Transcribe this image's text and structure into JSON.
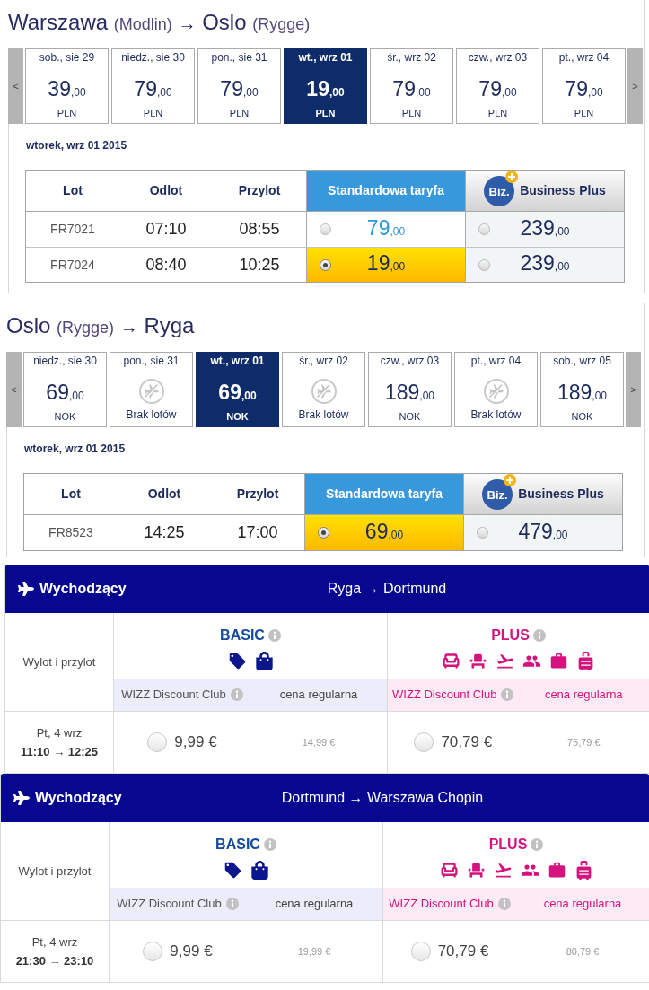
{
  "flights": [
    {
      "route": {
        "from": "Warszawa",
        "from_airport": "(Modlin)",
        "arrow": "→",
        "to": "Oslo",
        "to_airport": "(Rygge)"
      },
      "prev": "<",
      "next": ">",
      "dates": [
        {
          "kind": "price",
          "label": "sob., sie 29",
          "amount": "39",
          "fraction": ",00",
          "currency": "PLN",
          "selected": false
        },
        {
          "kind": "price",
          "label": "niedz., sie 30",
          "amount": "79",
          "fraction": ",00",
          "currency": "PLN",
          "selected": false
        },
        {
          "kind": "price",
          "label": "pon., sie 31",
          "amount": "79",
          "fraction": ",00",
          "currency": "PLN",
          "selected": false
        },
        {
          "kind": "price",
          "label": "wt., wrz 01",
          "amount": "19",
          "fraction": ",00",
          "currency": "PLN",
          "selected": true
        },
        {
          "kind": "price",
          "label": "śr., wrz 02",
          "amount": "79",
          "fraction": ",00",
          "currency": "PLN",
          "selected": false
        },
        {
          "kind": "price",
          "label": "czw., wrz 03",
          "amount": "79",
          "fraction": ",00",
          "currency": "PLN",
          "selected": false
        },
        {
          "kind": "price",
          "label": "pt., wrz 04",
          "amount": "79",
          "fraction": ",00",
          "currency": "PLN",
          "selected": false
        }
      ],
      "day_title": "wtorek, wrz 01 2015",
      "columns": [
        "Lot",
        "Odlot",
        "Przylot"
      ],
      "fare_columns": [
        {
          "kind": "standard",
          "label": "Standardowa taryfa"
        },
        {
          "kind": "business",
          "logo": "Biz.",
          "label": "Business Plus"
        }
      ],
      "rows": [
        {
          "flight": "FR7021",
          "departure": "07:10",
          "arrival": "08:55",
          "fares": [
            {
              "amount": "79",
              "fraction": ",00",
              "selected": false
            },
            {
              "amount": "239",
              "fraction": ",00",
              "selected": false
            }
          ]
        },
        {
          "flight": "FR7024",
          "departure": "08:40",
          "arrival": "10:25",
          "fares": [
            {
              "amount": "19",
              "fraction": ",00",
              "selected": true
            },
            {
              "amount": "239",
              "fraction": ",00",
              "selected": false
            }
          ]
        }
      ]
    },
    {
      "route": {
        "from": "Oslo",
        "from_airport": "(Rygge)",
        "arrow": "→",
        "to": "Ryga"
      },
      "prev": "<",
      "next": ">",
      "dates": [
        {
          "kind": "price",
          "label": "niedz., sie 30",
          "amount": "69",
          "fraction": ",00",
          "currency": "NOK",
          "selected": false
        },
        {
          "kind": "no_flights",
          "label": "pon., sie 31",
          "status": "Brak lotów",
          "selected": false
        },
        {
          "kind": "price",
          "label": "wt., wrz 01",
          "amount": "69",
          "fraction": ",00",
          "currency": "NOK",
          "selected": true
        },
        {
          "kind": "no_flights",
          "label": "śr., wrz 02",
          "status": "Brak lotów",
          "selected": false
        },
        {
          "kind": "price",
          "label": "czw., wrz 03",
          "amount": "189",
          "fraction": ",00",
          "currency": "NOK",
          "selected": false
        },
        {
          "kind": "no_flights",
          "label": "pt., wrz 04",
          "status": "Brak lotów",
          "selected": false
        },
        {
          "kind": "price",
          "label": "sob., wrz 05",
          "amount": "189",
          "fraction": ",00",
          "currency": "NOK",
          "selected": false
        }
      ],
      "day_title": "wtorek, wrz 01 2015",
      "columns": [
        "Lot",
        "Odlot",
        "Przylot"
      ],
      "fare_columns": [
        {
          "kind": "standard",
          "label": "Standardowa taryfa"
        },
        {
          "kind": "business",
          "logo": "Biz.",
          "label": "Business Plus"
        }
      ],
      "rows": [
        {
          "flight": "FR8523",
          "departure": "14:25",
          "arrival": "17:00",
          "fares": [
            {
              "amount": "69",
              "fraction": ",00",
              "selected": true
            },
            {
              "amount": "479",
              "fraction": ",00",
              "selected": false
            }
          ]
        }
      ]
    }
  ],
  "flight_cards": [
    {
      "direction": "Wychodzący",
      "route": "Ryga → Dortmund",
      "times_label": "Wylot i przylot",
      "date": "Pt, 4 wrz",
      "times": "11:10 → 12:25",
      "fares": [
        {
          "kind": "basic",
          "name": "BASIC",
          "club_label": "WIZZ Discount Club",
          "regular_label": "cena regularna",
          "club_price": "9,99 €",
          "regular_price": "14,99 €",
          "selected": false
        },
        {
          "kind": "plus",
          "name": "PLUS",
          "club_label": "WIZZ Discount Club",
          "regular_label": "cena regularna",
          "club_price": "70,79 €",
          "regular_price": "75,79 €",
          "selected": false
        }
      ]
    },
    {
      "direction": "Wychodzący",
      "route": "Dortmund → Warszawa Chopin",
      "times_label": "Wylot i przylot",
      "date": "Pt, 4 wrz",
      "times": "21:30 → 23:10",
      "fares": [
        {
          "kind": "basic",
          "name": "BASIC",
          "club_label": "WIZZ Discount Club",
          "regular_label": "cena regularna",
          "club_price": "9,99 €",
          "regular_price": "19,99 €",
          "selected": false
        },
        {
          "kind": "plus",
          "name": "PLUS",
          "club_label": "WIZZ Discount Club",
          "regular_label": "cena regularna",
          "club_price": "70,79 €",
          "regular_price": "80,79 €",
          "selected": false
        }
      ]
    }
  ]
}
